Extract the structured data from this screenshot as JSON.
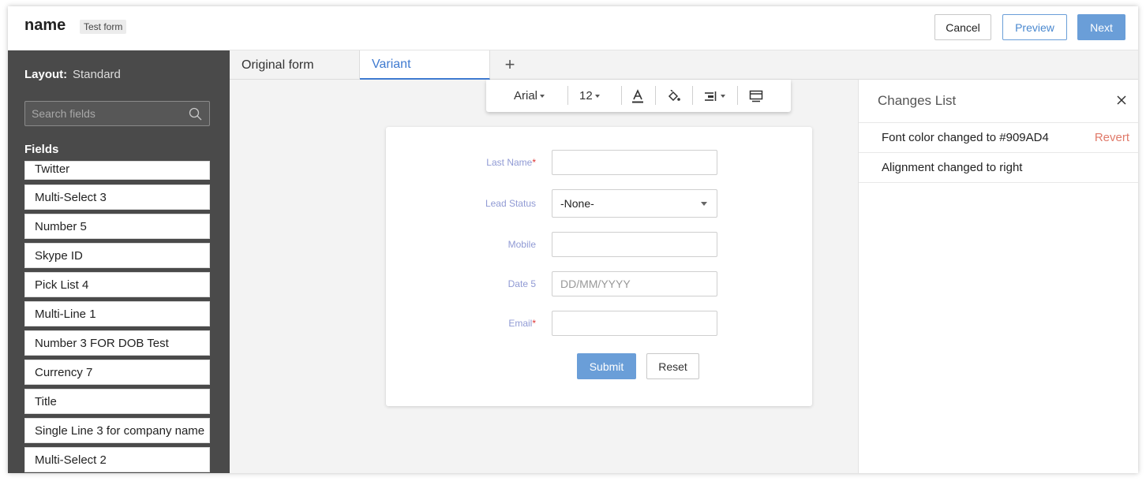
{
  "header": {
    "form_name": "name",
    "badge": "Test form",
    "cancel_label": "Cancel",
    "preview_label": "Preview",
    "next_label": "Next"
  },
  "sidebar": {
    "layout_label": "Layout:",
    "layout_value": "Standard",
    "search_placeholder": "Search fields",
    "fields_label": "Fields",
    "fields": [
      "Twitter",
      "Multi-Select 3",
      "Number 5",
      "Skype ID",
      "Pick List 4",
      "Multi-Line 1",
      "Number 3 FOR DOB Test",
      "Currency 7",
      "Title",
      "Single Line 3 for company name",
      "Multi-Select 2"
    ]
  },
  "tabs": {
    "original": "Original form",
    "variant": "Variant",
    "add": "+"
  },
  "toolbar": {
    "font": "Arial",
    "size": "12",
    "icons": [
      "text-color-icon",
      "fill-color-icon",
      "align-icon",
      "layout-icon"
    ]
  },
  "form": {
    "label_color": "#909AD4",
    "fields": {
      "last_name": "Last Name",
      "lead_status": "Lead Status",
      "lead_status_value": "-None-",
      "mobile": "Mobile",
      "date": "Date 5",
      "date_placeholder": "DD/MM/YYYY",
      "email": "Email"
    },
    "required_mark": "*",
    "submit_label": "Submit",
    "reset_label": "Reset"
  },
  "changes": {
    "title": "Changes List",
    "items": [
      {
        "text": "Font color changed to #909AD4",
        "action": "Revert"
      },
      {
        "text": "Alignment changed to right"
      }
    ]
  },
  "colors": {
    "accent": "#6a9ed8",
    "sidebar_bg": "#4a4a4a",
    "revert": "#e07a6a"
  }
}
